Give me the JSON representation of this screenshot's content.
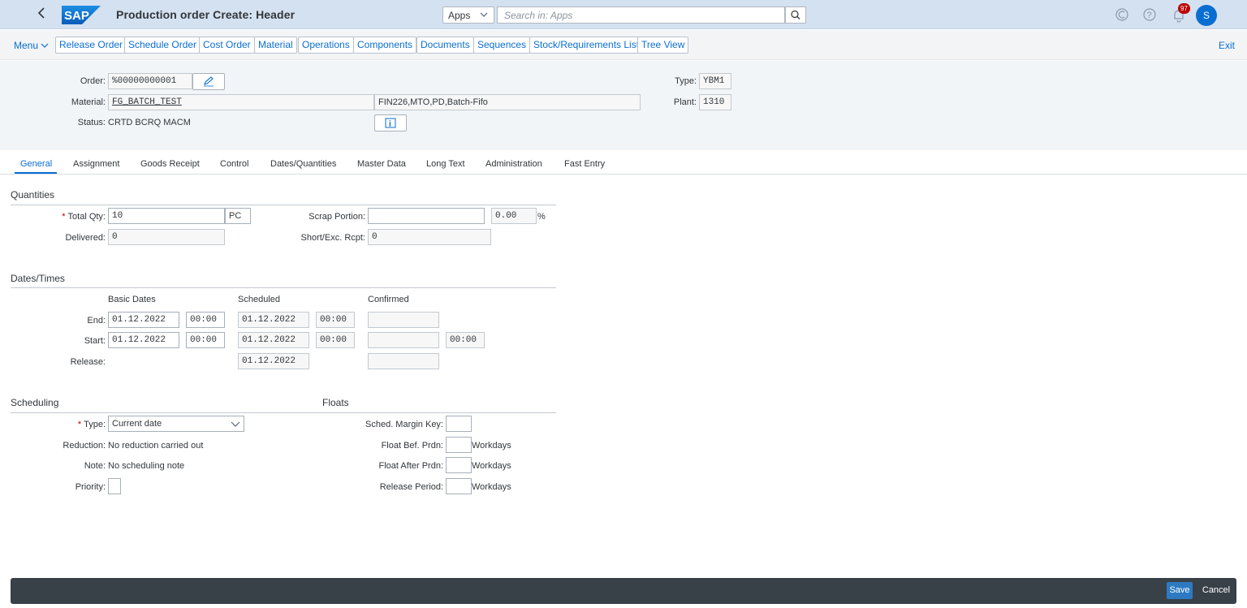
{
  "shell": {
    "logo_text": "SAP",
    "title": "Production order Create: Header",
    "apps_select": "Apps",
    "search_placeholder": "Search in: Apps",
    "notification_count": "97",
    "avatar_initial": "S"
  },
  "toolbar": {
    "menu_label": "Menu",
    "buttons": [
      "Release Order",
      "Schedule Order",
      "Cost Order",
      "Material",
      "Operations",
      "Components",
      "Documents",
      "Sequences",
      "Stock/Requirements List",
      "Tree View"
    ],
    "exit_label": "Exit"
  },
  "header": {
    "order_label": "Order:",
    "order_value": "%00000000001",
    "material_label": "Material:",
    "material_value": "FG_BATCH_TEST",
    "material_desc": "FIN226,MTO,PD,Batch-Fifo",
    "status_label": "Status:",
    "status_value": "CRTD BCRQ MACM",
    "type_label": "Type:",
    "type_value": "YBM1",
    "plant_label": "Plant:",
    "plant_value": "1310"
  },
  "tabs": [
    "General",
    "Assignment",
    "Goods Receipt",
    "Control",
    "Dates/Quantities",
    "Master Data",
    "Long Text",
    "Administration",
    "Fast Entry"
  ],
  "quantities": {
    "title": "Quantities",
    "total_qty_label": "Total Qty:",
    "total_qty_value": "10",
    "total_qty_unit": "PC",
    "scrap_label": "Scrap Portion:",
    "scrap_value": "",
    "scrap_pct": "0.00",
    "pct_sign": "%",
    "delivered_label": "Delivered:",
    "delivered_value": "0",
    "short_label": "Short/Exc. Rcpt:",
    "short_value": "0"
  },
  "dates": {
    "title": "Dates/Times",
    "col_basic": "Basic Dates",
    "col_scheduled": "Scheduled",
    "col_confirmed": "Confirmed",
    "end_label": "End:",
    "end_basic_date": "01.12.2022",
    "end_basic_time": "00:00",
    "end_sched_date": "01.12.2022",
    "end_sched_time": "00:00",
    "start_label": "Start:",
    "start_basic_date": "01.12.2022",
    "start_basic_time": "00:00",
    "start_sched_date": "01.12.2022",
    "start_sched_time": "00:00",
    "start_conf_time": "00:00",
    "release_label": "Release:",
    "release_sched_date": "01.12.2022"
  },
  "scheduling": {
    "title": "Scheduling",
    "type_label": "Type:",
    "type_value": "Current date",
    "reduction_label": "Reduction:",
    "reduction_value": "No reduction carried out",
    "note_label": "Note:",
    "note_value": "No scheduling note",
    "priority_label": "Priority:"
  },
  "floats": {
    "title": "Floats",
    "margin_key_label": "Sched. Margin Key:",
    "float_bef_label": "Float Bef. Prdn:",
    "float_after_label": "Float After Prdn:",
    "release_period_label": "Release Period:",
    "unit": "Workdays"
  },
  "footer": {
    "save_label": "Save",
    "cancel_label": "Cancel"
  }
}
